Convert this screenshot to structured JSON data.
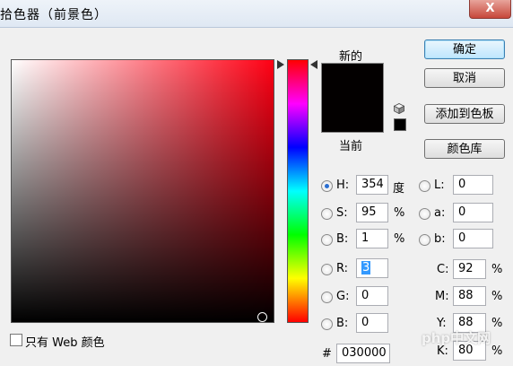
{
  "dialog": {
    "title": "拾色器（前景色）",
    "close_label": "X"
  },
  "preview": {
    "new_label": "新的",
    "current_label": "当前",
    "new_color": "#030000",
    "current_color": "#030000"
  },
  "buttons": {
    "ok": "确定",
    "cancel": "取消",
    "add_to_swatches": "添加到色板",
    "color_libraries": "颜色库"
  },
  "hsb": {
    "h_label": "H:",
    "h_value": "354",
    "h_unit": "度",
    "s_label": "S:",
    "s_value": "95",
    "s_unit": "%",
    "b_label": "B:",
    "b_value": "1",
    "b_unit": "%"
  },
  "lab": {
    "l_label": "L:",
    "l_value": "0",
    "a_label": "a:",
    "a_value": "0",
    "b_label": "b:",
    "b_value": "0"
  },
  "rgb": {
    "r_label": "R:",
    "r_value": "3",
    "g_label": "G:",
    "g_value": "0",
    "b_label": "B:",
    "b_value": "0"
  },
  "cmyk": {
    "c_label": "C:",
    "c_value": "92",
    "c_unit": "%",
    "m_label": "M:",
    "m_value": "88",
    "m_unit": "%",
    "y_label": "Y:",
    "y_value": "88",
    "y_unit": "%",
    "k_label": "K:",
    "k_value": "80",
    "k_unit": "%"
  },
  "hex": {
    "label": "#",
    "value": "030000"
  },
  "web_only": {
    "label": "只有 Web 颜色",
    "checked": false
  },
  "selected_mode": "H",
  "watermark": "php中文网",
  "field_hue_color": "#ff0014"
}
